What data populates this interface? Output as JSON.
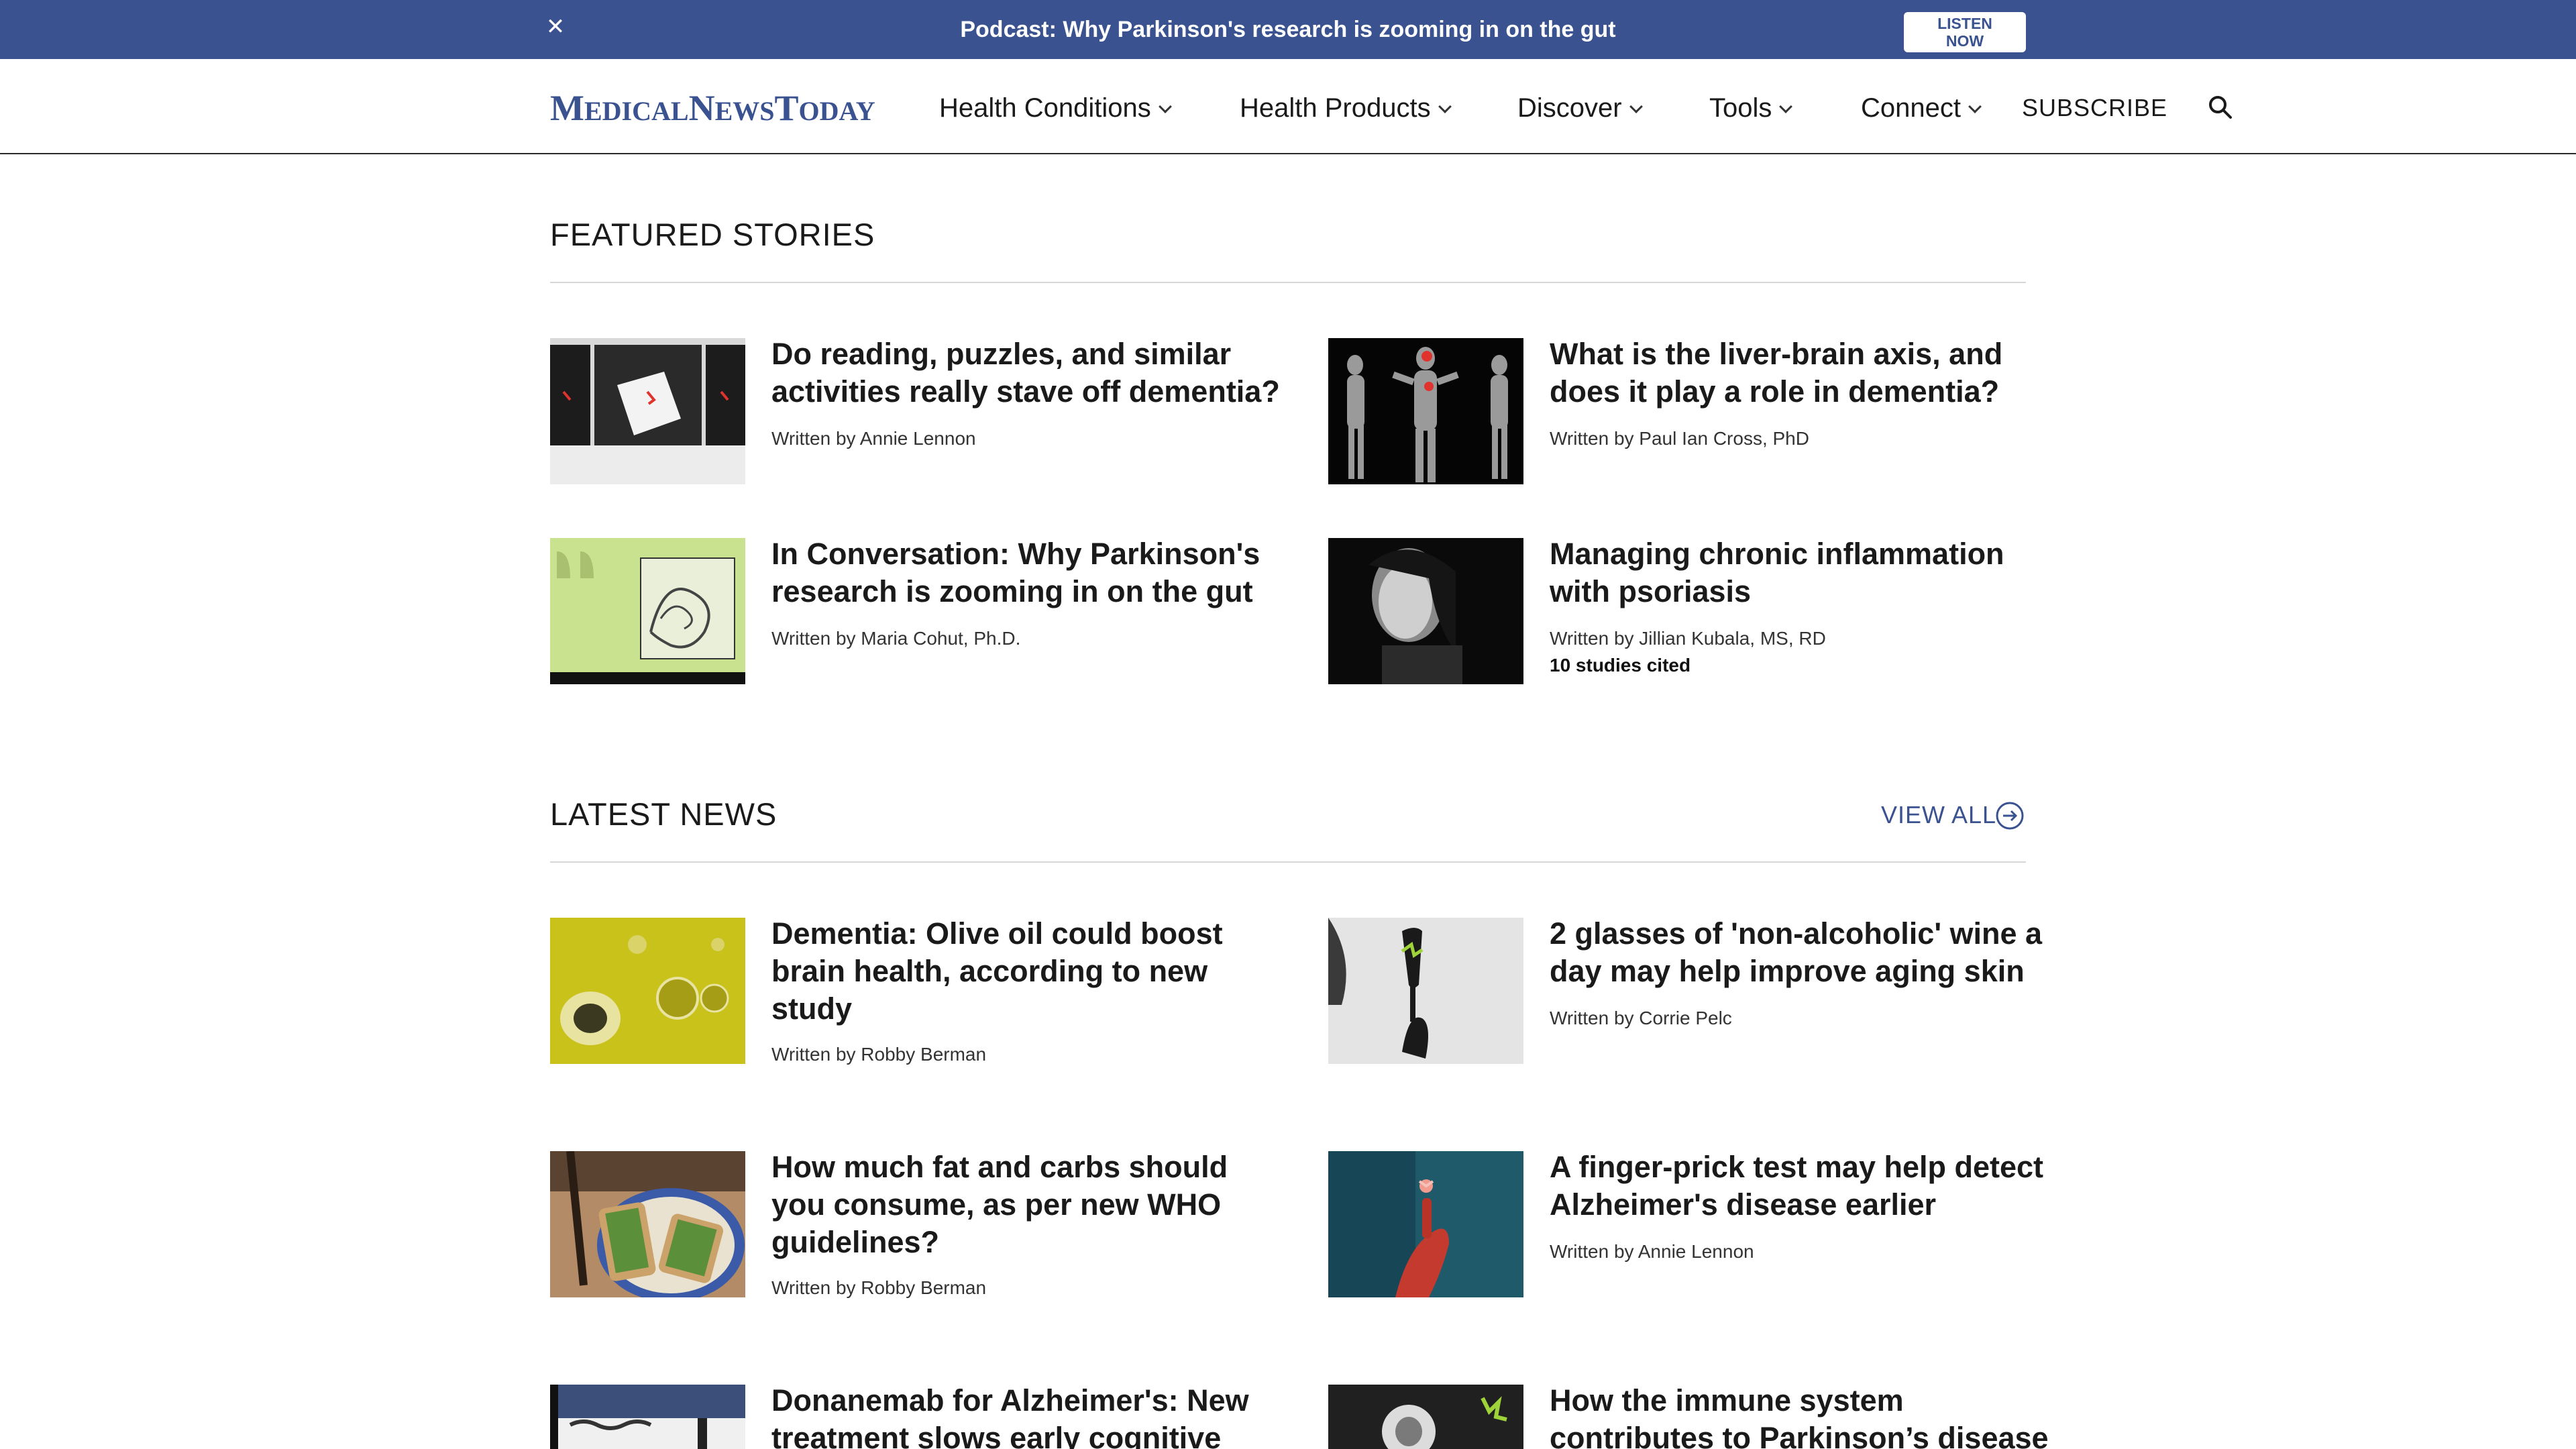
{
  "banner": {
    "text": "Podcast: Why Parkinson's research is zooming in on the gut",
    "button_line1": "LISTEN",
    "button_line2": "NOW",
    "close_icon": "close-icon"
  },
  "header": {
    "logo_parts": [
      "M",
      "EDICAL",
      "N",
      "EWS",
      "T",
      "ODAY"
    ],
    "nav": [
      "Health Conditions",
      "Health Products",
      "Discover",
      "Tools",
      "Connect"
    ],
    "subscribe": "SUBSCRIBE",
    "search_icon": "search-icon"
  },
  "featured": {
    "title": "FEATURED STORIES",
    "items": [
      {
        "title": "Do reading, puzzles, and similar activities really stave off dementia?",
        "byline": "Written by Annie Lennon",
        "extra": ""
      },
      {
        "title": "What is the liver-brain axis, and does it play a role in dementia?",
        "byline": "Written by Paul Ian Cross, PhD",
        "extra": ""
      },
      {
        "title": "In Conversation: Why Parkinson's research is zooming in on the gut",
        "byline": "Written by Maria Cohut, Ph.D.",
        "extra": ""
      },
      {
        "title": "Managing chronic inflammation with psoriasis",
        "byline": "Written by Jillian Kubala, MS, RD",
        "extra": "10 studies cited"
      }
    ]
  },
  "latest": {
    "title": "LATEST NEWS",
    "view_all": "VIEW ALL",
    "items": [
      {
        "title": "Dementia: Olive oil could boost brain health, according to new study",
        "byline": "Written by Robby Berman"
      },
      {
        "title": "2 glasses of 'non-alcoholic' wine a day may help improve aging skin",
        "byline": "Written by Corrie Pelc"
      },
      {
        "title": "How much fat and carbs should you consume, as per new WHO guidelines?",
        "byline": "Written by Robby Berman"
      },
      {
        "title": "A finger-prick test may help detect Alzheimer's disease earlier",
        "byline": "Written by Annie Lennon"
      },
      {
        "title": "Donanemab for Alzheimer's: New treatment slows early cognitive",
        "byline": ""
      },
      {
        "title": "How the immune system contributes to Parkinson’s disease",
        "byline": ""
      }
    ]
  },
  "colors": {
    "brand": "#3a5290",
    "text": "#1a1a1a",
    "rule": "#d7d7d7"
  }
}
